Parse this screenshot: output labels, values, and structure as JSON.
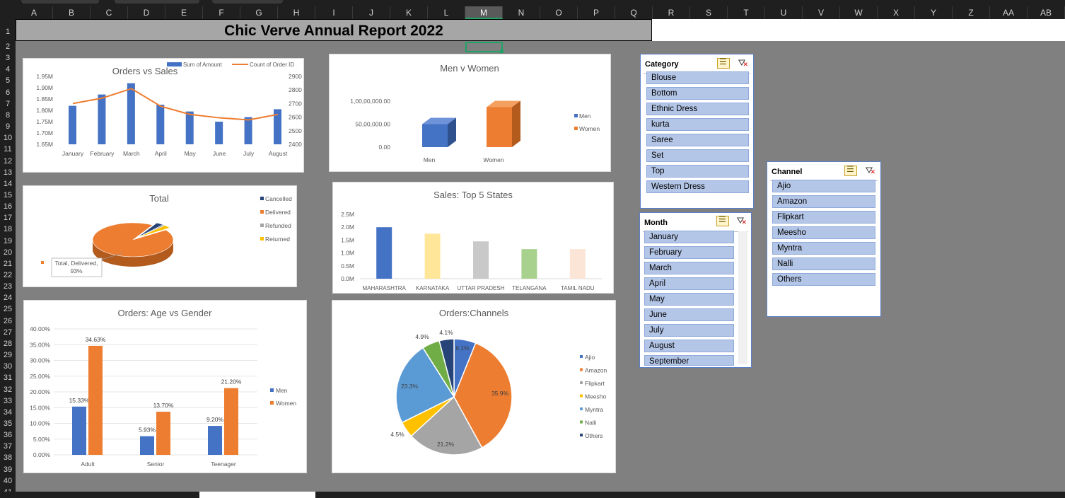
{
  "sheet": {
    "columns": [
      "A",
      "B",
      "C",
      "D",
      "E",
      "F",
      "G",
      "H",
      "I",
      "J",
      "K",
      "L",
      "M",
      "N",
      "O",
      "P",
      "Q",
      "R",
      "S",
      "T",
      "U",
      "V",
      "W",
      "X",
      "Y",
      "Z",
      "AA",
      "AB"
    ],
    "selected_column": "M",
    "rows": [
      "1",
      "2",
      "3",
      "4",
      "5",
      "6",
      "7",
      "8",
      "9",
      "10",
      "11",
      "12",
      "13",
      "14",
      "15",
      "16",
      "17",
      "18",
      "19",
      "20",
      "21",
      "22",
      "23",
      "24",
      "25",
      "26",
      "27",
      "28",
      "29",
      "30",
      "31",
      "32",
      "33",
      "34",
      "35",
      "36",
      "37",
      "38",
      "39",
      "40",
      "41"
    ]
  },
  "report": {
    "title": "Chic Verve Annual Report 2022"
  },
  "chart_data": [
    {
      "id": "orders_vs_sales",
      "type": "bar",
      "title": "Orders vs Sales",
      "categories": [
        "January",
        "February",
        "March",
        "April",
        "May",
        "June",
        "July",
        "August"
      ],
      "series": [
        {
          "name": "Sum of Amount",
          "kind": "bar",
          "axis": "left",
          "color": "#4472c4",
          "values": [
            1.82,
            1.87,
            1.92,
            1.825,
            1.795,
            1.75,
            1.77,
            1.805
          ]
        },
        {
          "name": "Count of Order ID",
          "kind": "line",
          "axis": "right",
          "color": "#ed7d31",
          "values": [
            2700,
            2740,
            2810,
            2680,
            2620,
            2595,
            2580,
            2620
          ]
        }
      ],
      "left_ticks": [
        "1.95M",
        "1.90M",
        "1.85M",
        "1.80M",
        "1.75M",
        "1.70M",
        "1.65M"
      ],
      "ylim_left": [
        1.65,
        1.95
      ],
      "right_ticks": [
        "2900",
        "2800",
        "2700",
        "2600",
        "2500",
        "2400"
      ],
      "ylim_right": [
        2400,
        2900
      ],
      "legend": "top-right"
    },
    {
      "id": "men_v_women",
      "type": "bar",
      "title": "Men v Women",
      "categories": [
        "Men",
        "Women"
      ],
      "values": [
        5000000,
        8700000
      ],
      "colors": [
        "#4472c4",
        "#ed7d31"
      ],
      "y_ticks": [
        "1,00,00,000.00",
        "50,00,000.00",
        "0.00"
      ],
      "ylim": [
        0,
        10000000
      ],
      "legend": [
        "Men",
        "Women"
      ]
    },
    {
      "id": "total",
      "type": "pie",
      "title": "Total",
      "labels": [
        "Cancelled",
        "Delivered",
        "Refunded",
        "Returned"
      ],
      "values": [
        3,
        93,
        1,
        3
      ],
      "colors": [
        "#264478",
        "#ed7d31",
        "#a5a5a5",
        "#ffc000"
      ],
      "callout": "Total, Delivered,\n93%"
    },
    {
      "id": "top5_states",
      "type": "bar",
      "title": "Sales: Top 5 States",
      "categories": [
        "MAHARASHTRA",
        "KARNATAKA",
        "UTTAR PRADESH",
        "TELANGANA",
        "TAMIL NADU"
      ],
      "values": [
        2.0,
        1.75,
        1.45,
        1.15,
        1.15
      ],
      "colors": [
        "#4472c4",
        "#ffe699",
        "#c9c9c9",
        "#a9d18e",
        "#fbe5d6"
      ],
      "y_ticks": [
        "2.5M",
        "2.0M",
        "1.5M",
        "1.0M",
        "0.5M",
        "0.0M"
      ],
      "ylim": [
        0,
        2.5
      ]
    },
    {
      "id": "age_vs_gender",
      "type": "bar",
      "title": "Orders: Age vs Gender",
      "categories": [
        "Adult",
        "Senior",
        "Teenager"
      ],
      "series": [
        {
          "name": "Men",
          "color": "#4472c4",
          "values": [
            15.33,
            5.93,
            9.2
          ],
          "labels": [
            "15.33%",
            "5.93%",
            "9.20%"
          ]
        },
        {
          "name": "Women",
          "color": "#ed7d31",
          "values": [
            34.63,
            13.7,
            21.2
          ],
          "labels": [
            "34.63%",
            "13.70%",
            "21.20%"
          ]
        }
      ],
      "y_ticks": [
        "40.00%",
        "35.00%",
        "30.00%",
        "25.00%",
        "20.00%",
        "15.00%",
        "10.00%",
        "5.00%",
        "0.00%"
      ],
      "ylim": [
        0,
        40
      ]
    },
    {
      "id": "channels",
      "type": "pie",
      "title": "Orders:Channels",
      "labels": [
        "Ajio",
        "Amazon",
        "Flipkart",
        "Meesho",
        "Myntra",
        "Nalli",
        "Others"
      ],
      "values": [
        6.1,
        35.9,
        21.2,
        4.5,
        23.3,
        4.9,
        4.1
      ],
      "value_labels": [
        "6.1%",
        "35.9%",
        "21.2%",
        "4.5%",
        "23.3%",
        "4.9%",
        "4.1%"
      ],
      "colors": [
        "#4472c4",
        "#ed7d31",
        "#a5a5a5",
        "#ffc000",
        "#5b9bd5",
        "#70ad47",
        "#264478"
      ]
    }
  ],
  "slicers": {
    "category": {
      "title": "Category",
      "items": [
        "Blouse",
        "Bottom",
        "Ethnic Dress",
        "kurta",
        "Saree",
        "Set",
        "Top",
        "Western Dress"
      ]
    },
    "month": {
      "title": "Month",
      "items": [
        "January",
        "February",
        "March",
        "April",
        "May",
        "June",
        "July",
        "August",
        "September"
      ]
    },
    "channel": {
      "title": "Channel",
      "items": [
        "Ajio",
        "Amazon",
        "Flipkart",
        "Meesho",
        "Myntra",
        "Nalli",
        "Others"
      ]
    }
  }
}
